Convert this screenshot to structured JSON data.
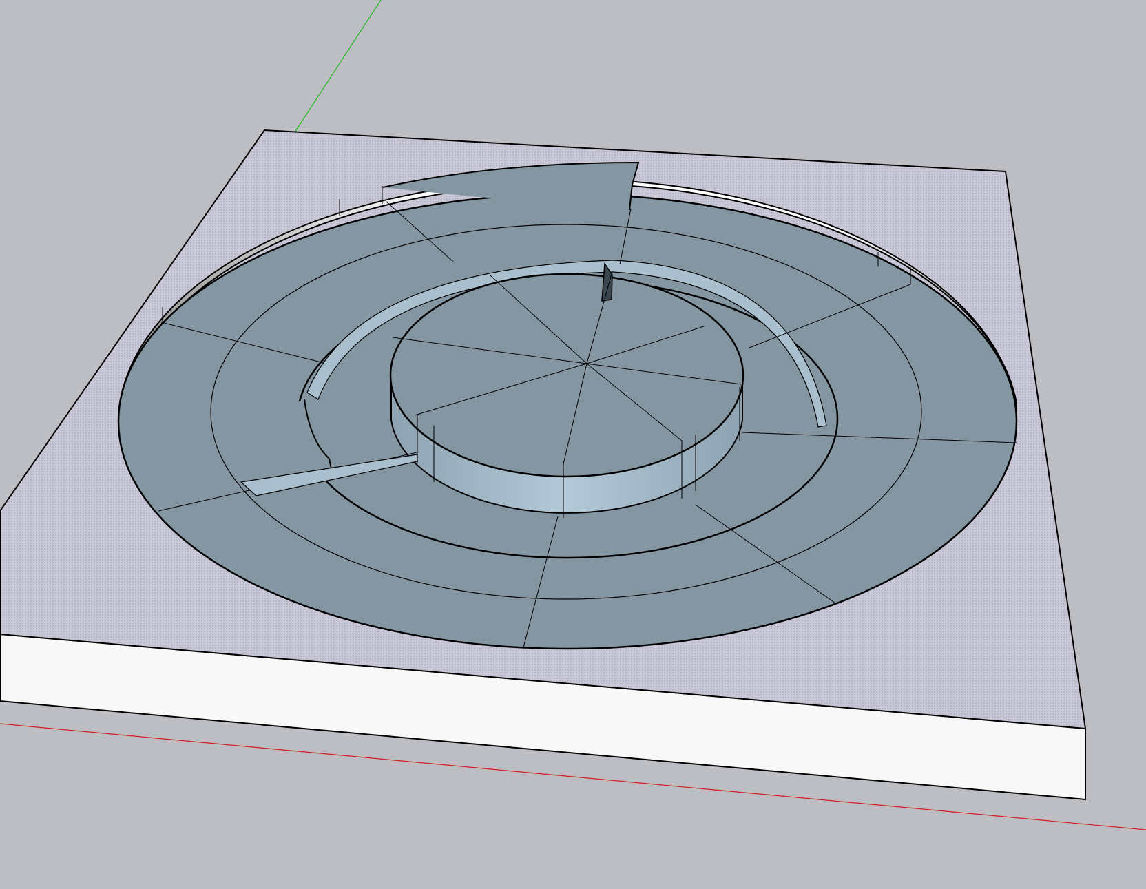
{
  "viewport": {
    "background": "#bdbec3",
    "colors": {
      "green_axis": "#1fb81f",
      "red_axis": "#d21e1e",
      "plate_top": "#c9c8d6",
      "plate_side": "#f8f8f8",
      "floor": "#8596a3",
      "wall": "#a9bfce",
      "edge": "#000000"
    },
    "axes": [
      "green-axis",
      "red-axis"
    ],
    "model": {
      "name": "circular-maze-plate",
      "rings": 3,
      "floor_segments": 8
    }
  }
}
